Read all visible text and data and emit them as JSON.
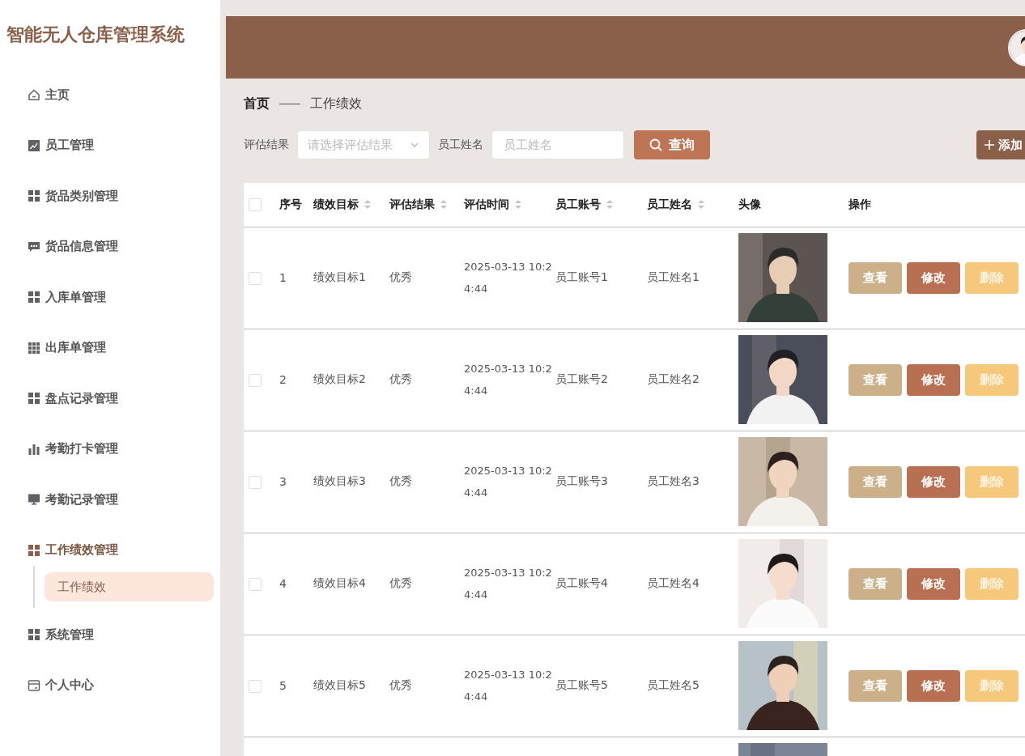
{
  "app_title": "智能无人仓库管理系统",
  "sidebar": {
    "items": [
      {
        "label": "主页",
        "selected": false
      },
      {
        "label": "员工管理",
        "selected": false
      },
      {
        "label": "货品类别管理",
        "selected": false
      },
      {
        "label": "货品信息管理",
        "selected": false
      },
      {
        "label": "入库单管理",
        "selected": false
      },
      {
        "label": "出库单管理",
        "selected": false
      },
      {
        "label": "盘点记录管理",
        "selected": false
      },
      {
        "label": "考勤打卡管理",
        "selected": false
      },
      {
        "label": "考勤记录管理",
        "selected": false
      },
      {
        "label": "工作绩效管理",
        "selected": true,
        "expanded": true,
        "children": [
          {
            "label": "工作绩效",
            "selected": true
          }
        ]
      },
      {
        "label": "系统管理",
        "selected": false
      },
      {
        "label": "个人中心",
        "selected": false
      }
    ]
  },
  "header": {
    "avatar": {
      "kind": "picture"
    }
  },
  "breadcrumb": [
    "首页",
    "工作绩效"
  ],
  "filters": [
    {
      "label": "评估结果",
      "kind": "select",
      "placeholder": "请选择评估结果"
    },
    {
      "label": "员工姓名",
      "kind": "input",
      "placeholder": "员工姓名"
    }
  ],
  "search_button": "查询",
  "add_button": "添加",
  "table": {
    "all_checked": false,
    "columns": [
      {
        "label": "序号",
        "sortable": false
      },
      {
        "label": "绩效目标",
        "sortable": true
      },
      {
        "label": "评估结果",
        "sortable": true
      },
      {
        "label": "评估时间",
        "sortable": true
      },
      {
        "label": "员工账号",
        "sortable": true
      },
      {
        "label": "员工姓名",
        "sortable": true
      },
      {
        "label": "头像",
        "sortable": false
      },
      {
        "label": "操作",
        "sortable": false
      }
    ],
    "rows": [
      {
        "checked": false,
        "cells": [
          "1",
          "绩效目标1",
          "优秀",
          "2025-03-13 10:24:44",
          "员工账号1",
          "员工姓名1"
        ],
        "avatar": {
          "kind": "picture"
        },
        "actions": [
          "查看",
          "修改",
          "删除"
        ]
      },
      {
        "checked": false,
        "cells": [
          "2",
          "绩效目标2",
          "优秀",
          "2025-03-13 10:24:44",
          "员工账号2",
          "员工姓名2"
        ],
        "avatar": {
          "kind": "picture"
        },
        "actions": [
          "查看",
          "修改",
          "删除"
        ]
      },
      {
        "checked": false,
        "cells": [
          "3",
          "绩效目标3",
          "优秀",
          "2025-03-13 10:24:44",
          "员工账号3",
          "员工姓名3"
        ],
        "avatar": {
          "kind": "picture"
        },
        "actions": [
          "查看",
          "修改",
          "删除"
        ]
      },
      {
        "checked": false,
        "cells": [
          "4",
          "绩效目标4",
          "优秀",
          "2025-03-13 10:24:44",
          "员工账号4",
          "员工姓名4"
        ],
        "avatar": {
          "kind": "picture"
        },
        "actions": [
          "查看",
          "修改",
          "删除"
        ]
      },
      {
        "checked": false,
        "cells": [
          "5",
          "绩效目标5",
          "优秀",
          "2025-03-13 10:24:44",
          "员工账号5",
          "员工姓名5"
        ],
        "avatar": {
          "kind": "picture"
        },
        "actions": [
          "查看",
          "修改",
          "删除"
        ]
      },
      {
        "avatar": {
          "kind": "picture"
        }
      }
    ]
  }
}
